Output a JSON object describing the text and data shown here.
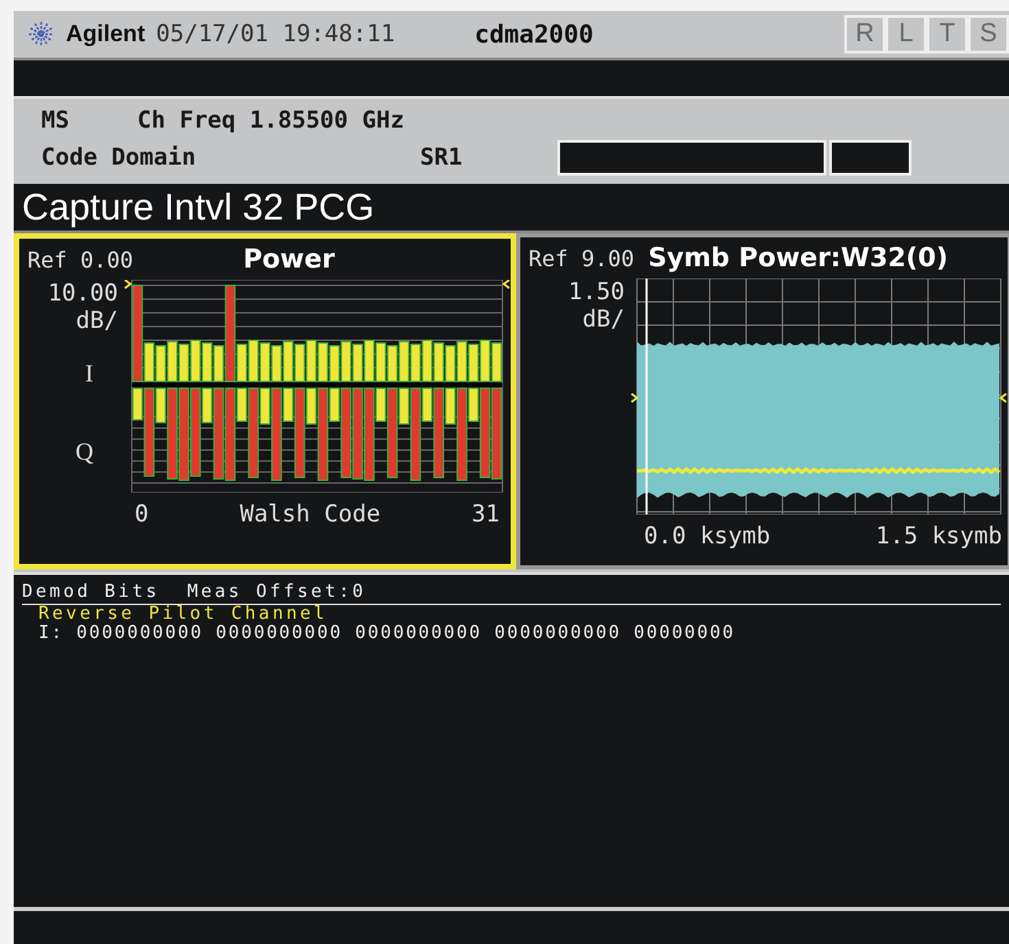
{
  "header": {
    "brand": "Agilent",
    "datetime": "05/17/01 19:48:11",
    "mode": "cdma2000",
    "annunciators": [
      "R",
      "L",
      "T",
      "S"
    ]
  },
  "info": {
    "device": "MS",
    "frequency": "Ch Freq 1.85500 GHz",
    "measurement": "Code Domain",
    "spreading_rate": "SR1"
  },
  "title": "Capture Intvl 32 PCG",
  "panels": [
    {
      "kind": "power",
      "selected": true,
      "ref": "Ref 0.00",
      "heading": "Power",
      "scale": "10.00",
      "scale_unit": "dB/",
      "i_label": "I",
      "q_label": "Q",
      "x_start": "0",
      "x_label": "Walsh Code",
      "x_end": "31"
    },
    {
      "kind": "symbol",
      "selected": false,
      "ref": "Ref 9.00",
      "heading": "Symb Power:W32(0)",
      "scale": "1.50",
      "scale_unit": "dB/",
      "x_start": "0.0 ksymb",
      "x_end": "1.5 ksymb"
    }
  ],
  "demod": {
    "heading": "Demod Bits  Meas Offset:0",
    "channel": "Reverse Pilot Channel",
    "bits": "I: 0000000000 0000000000 0000000000 0000000000 00000000"
  }
}
